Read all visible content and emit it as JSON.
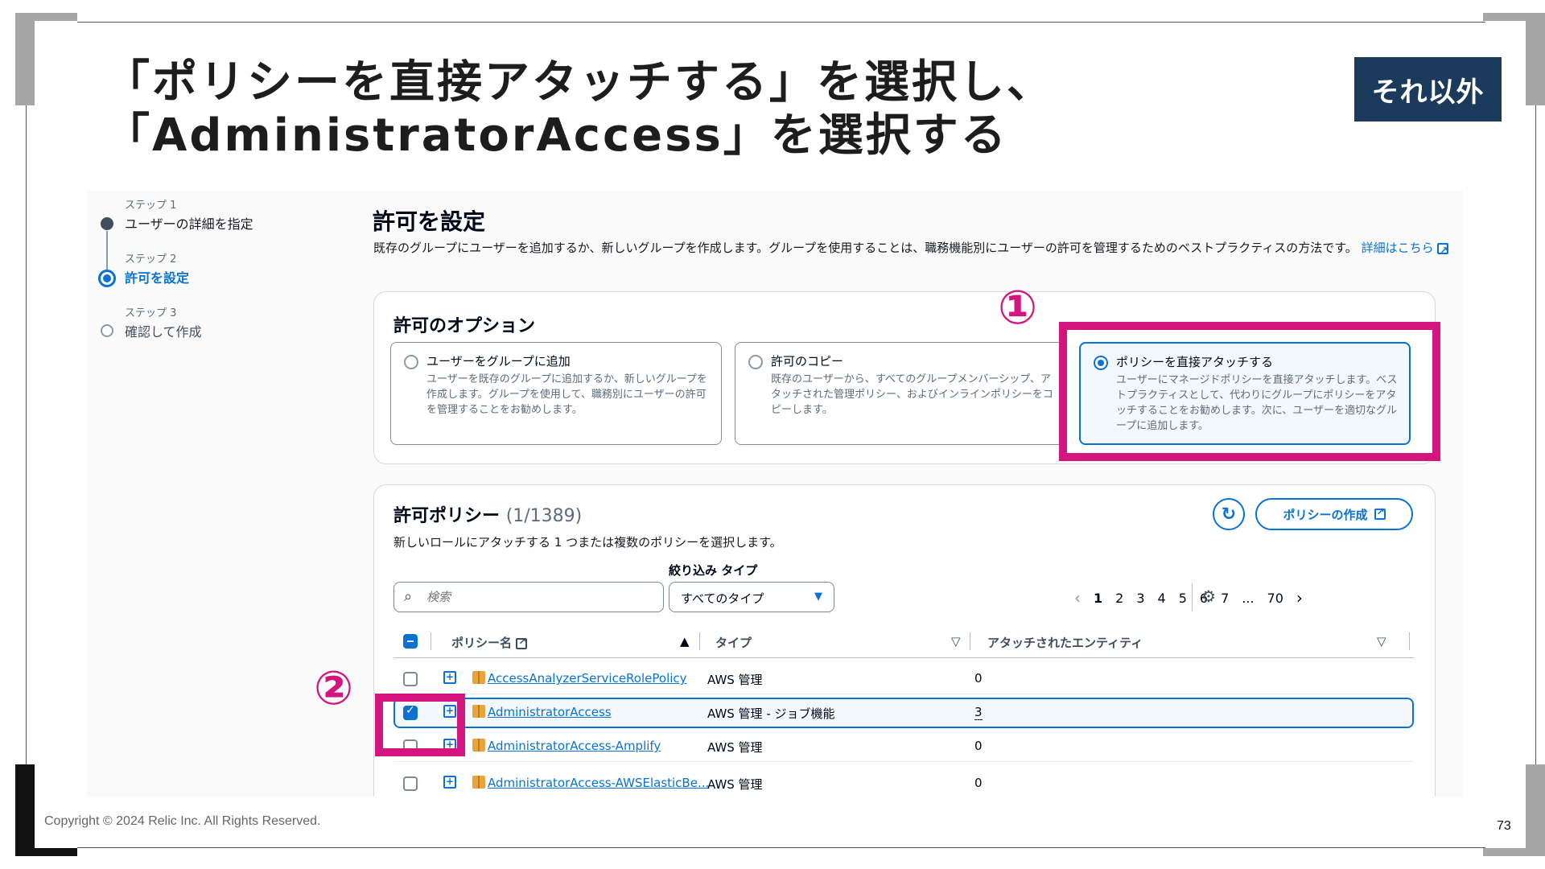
{
  "slide": {
    "title_line1": "「ポリシーを直接アタッチする」を選択し、",
    "title_line2": "「AdministratorAccess」を選択する",
    "badge": "それ以外",
    "copyright": "Copyright © 2024 Relic Inc. All Rights Reserved.",
    "page_number": "73"
  },
  "steps": [
    {
      "number": "ステップ 1",
      "label": "ユーザーの詳細を指定",
      "state": "done"
    },
    {
      "number": "ステップ 2",
      "label": "許可を設定",
      "state": "current"
    },
    {
      "number": "ステップ 3",
      "label": "確認して作成",
      "state": "pending"
    }
  ],
  "main": {
    "title": "許可を設定",
    "description": "既存のグループにユーザーを追加するか、新しいグループを作成します。グループを使用することは、職務機能別にユーザーの許可を管理するためのベストプラクティスの方法です。",
    "learn_more": "詳細はこちら"
  },
  "options_panel": {
    "title": "許可のオプション",
    "options": [
      {
        "title": "ユーザーをグループに追加",
        "description": "ユーザーを既存のグループに追加するか、新しいグループを作成します。グループを使用して、職務別にユーザーの許可を管理することをお勧めします。",
        "selected": false
      },
      {
        "title": "許可のコピー",
        "description": "既存のユーザーから、すべてのグループメンバーシップ、アタッチされた管理ポリシー、およびインラインポリシーをコピーします。",
        "selected": false
      },
      {
        "title": "ポリシーを直接アタッチする",
        "description": "ユーザーにマネージドポリシーを直接アタッチします。ベストプラクティスとして、代わりにグループにポリシーをアタッチすることをお勧めします。次に、ユーザーを適切なグループに追加します。",
        "selected": true
      }
    ]
  },
  "policies_panel": {
    "title": "許可ポリシー",
    "count": "(1/1389)",
    "subtitle": "新しいロールにアタッチする 1 つまたは複数のポリシーを選択します。",
    "create_button": "ポリシーの作成",
    "filter_label": "絞り込み タイプ",
    "search_placeholder": "検索",
    "filter_value": "すべてのタイプ",
    "pagination": [
      "1",
      "2",
      "3",
      "4",
      "5",
      "6",
      "7",
      "...",
      "70"
    ],
    "current_page": "1",
    "columns": [
      "ポリシー名",
      "タイプ",
      "アタッチされたエンティティ"
    ],
    "rows": [
      {
        "name": "AccessAnalyzerServiceRolePolicy",
        "type": "AWS 管理",
        "entities": "0",
        "checked": false
      },
      {
        "name": "AdministratorAccess",
        "type": "AWS 管理 - ジョブ機能",
        "entities": "3",
        "checked": true
      },
      {
        "name": "AdministratorAccess-Amplify",
        "type": "AWS 管理",
        "entities": "0",
        "checked": false
      },
      {
        "name": "AdministratorAccess-AWSElasticBe...",
        "type": "AWS 管理",
        "entities": "0",
        "checked": false
      }
    ]
  },
  "annotations": {
    "marker1": "①",
    "marker2": "②",
    "color": "#d4147f"
  },
  "colors": {
    "aws_blue": "#0972d3",
    "badge_bg": "#1b3a5c"
  }
}
